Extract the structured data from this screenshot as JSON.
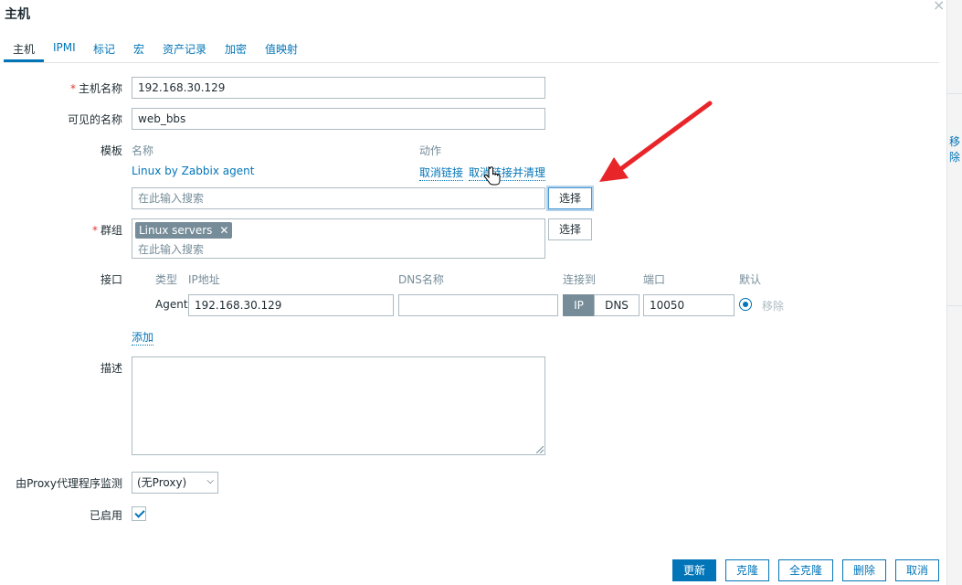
{
  "dialog": {
    "title": "主机",
    "close": "×"
  },
  "tabs": [
    {
      "label": "主机"
    },
    {
      "label": "IPMI"
    },
    {
      "label": "标记"
    },
    {
      "label": "宏"
    },
    {
      "label": "资产记录"
    },
    {
      "label": "加密"
    },
    {
      "label": "值映射"
    }
  ],
  "form": {
    "host_name": {
      "required_mark": "*",
      "label": "主机名称",
      "value": "192.168.30.129"
    },
    "visible_name": {
      "label": "可见的名称",
      "value": "web_bbs"
    },
    "templates": {
      "label": "模板",
      "col_name": "名称",
      "col_action": "动作",
      "linked": [
        {
          "name": "Linux by Zabbix agent",
          "unlink": "取消链接",
          "unlink_clear": "取消链接并清理"
        }
      ],
      "search_placeholder": "在此输入搜索",
      "select_button": "选择"
    },
    "groups": {
      "required_mark": "*",
      "label": "群组",
      "chips": [
        {
          "name": "Linux servers",
          "remove": "✕"
        }
      ],
      "search_placeholder": "在此输入搜索",
      "select_button": "选择"
    },
    "interfaces": {
      "label": "接口",
      "headers": {
        "type": "类型",
        "ip": "IP地址",
        "dns": "DNS名称",
        "connect": "连接到",
        "port": "端口",
        "default": "默认"
      },
      "rows": [
        {
          "type": "Agent",
          "ip": "192.168.30.129",
          "dns": "",
          "connect_ip": "IP",
          "connect_dns": "DNS",
          "connect_selected": "IP",
          "port": "10050",
          "remove": "移除"
        }
      ],
      "add": "添加"
    },
    "description": {
      "label": "描述",
      "value": ""
    },
    "proxy": {
      "label": "由Proxy代理程序监测",
      "value": "(无Proxy)",
      "chevron": "⌵"
    },
    "enabled": {
      "label": "已启用",
      "checked": true
    }
  },
  "footer": {
    "update": "更新",
    "clone": "克隆",
    "full_clone": "全克隆",
    "delete": "删除",
    "cancel": "取消"
  },
  "background": {
    "partial_link": "移除"
  },
  "colors": {
    "accent": "#0275b8",
    "required": "#e33734",
    "annotation_arrow": "#e8262a"
  }
}
